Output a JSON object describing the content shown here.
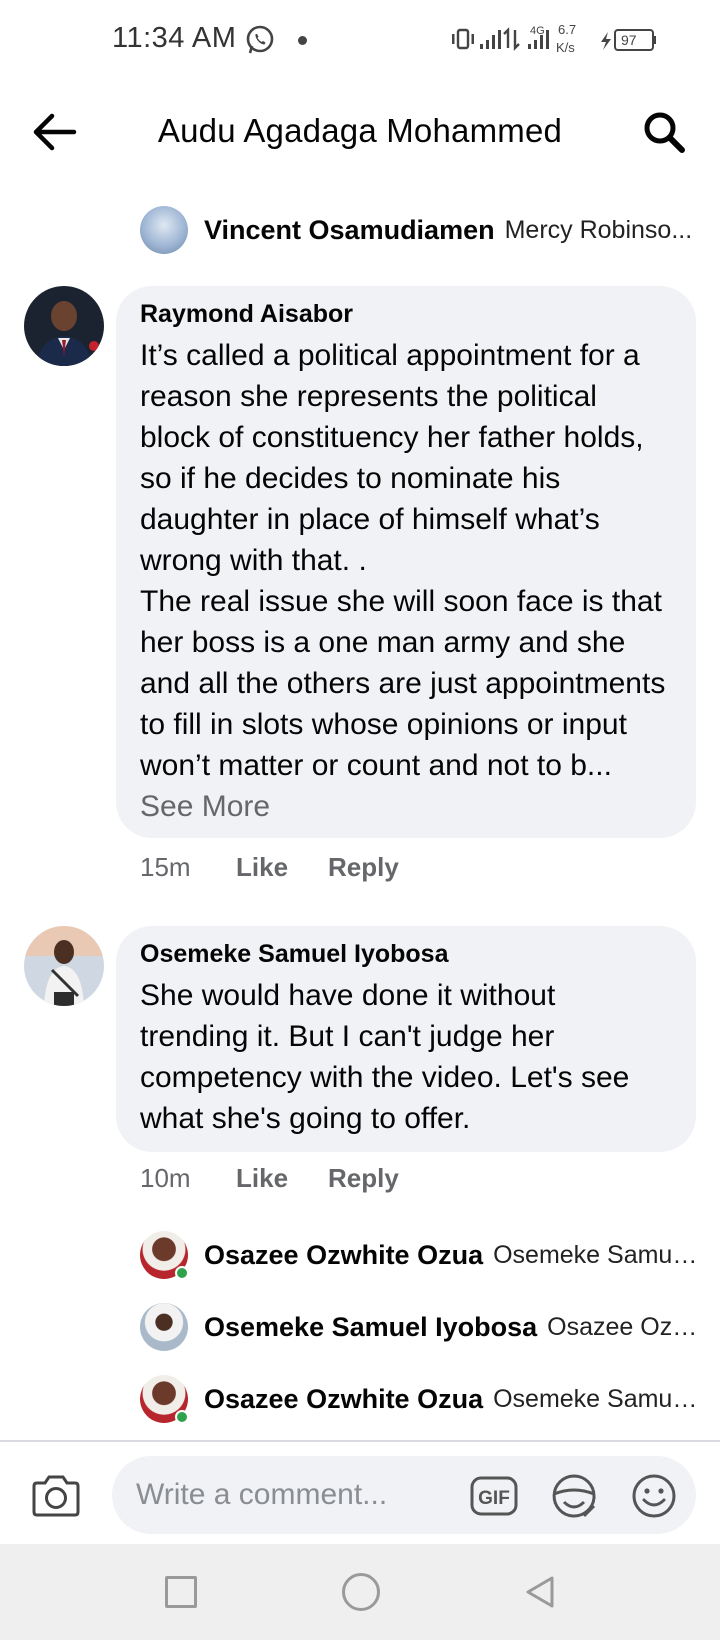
{
  "status_bar": {
    "time": "11:34 AM",
    "net_speed_value": "6.7",
    "net_speed_unit": "K/s",
    "network_type": "4G",
    "battery": "97",
    "icons": [
      "whatsapp-icon",
      "vibrate-icon",
      "signal-icon",
      "data-arrows-icon",
      "signal-4g-icon",
      "charging-icon",
      "battery-icon"
    ]
  },
  "header": {
    "title": "Audu Agadaga Mohammed",
    "back_icon": "back-arrow-icon",
    "search_icon": "search-icon"
  },
  "top_reply": {
    "name": "Vincent Osamudiamen",
    "snippet": "Mercy Robinso..."
  },
  "comments": [
    {
      "author": "Raymond Aisabor",
      "text": "It’s called a political appointment for a reason she represents the political block of constituency her father holds, so if he decides to nominate his daughter in place of himself what’s wrong with that. .\nThe real issue she will soon face is that her boss is a one man army and she and all the others are just appointments to fill in slots whose opinions or input won’t matter or count and not to b...",
      "see_more": "See More",
      "time": "15m",
      "like": "Like",
      "reply": "Reply"
    },
    {
      "author": "Osemeke Samuel Iyobosa",
      "text": "She would have done it without trending it. But I can't judge her competency with the video. Let's see what she's going to offer.",
      "time": "10m",
      "like": "Like",
      "reply": "Reply"
    }
  ],
  "replies": [
    {
      "name": "Osazee Ozwhite Ozua",
      "snippet": "Osemeke Samue..."
    },
    {
      "name": "Osemeke Samuel Iyobosa",
      "snippet": "Osazee Ozw..."
    },
    {
      "name": "Osazee Ozwhite Ozua",
      "snippet": "Osemeke Samue..."
    }
  ],
  "composer": {
    "placeholder": "Write a comment...",
    "gif_label": "GIF"
  },
  "colors": {
    "bubble": "#f0f2f5",
    "meta_text": "#65676b",
    "online": "#31a24c"
  }
}
